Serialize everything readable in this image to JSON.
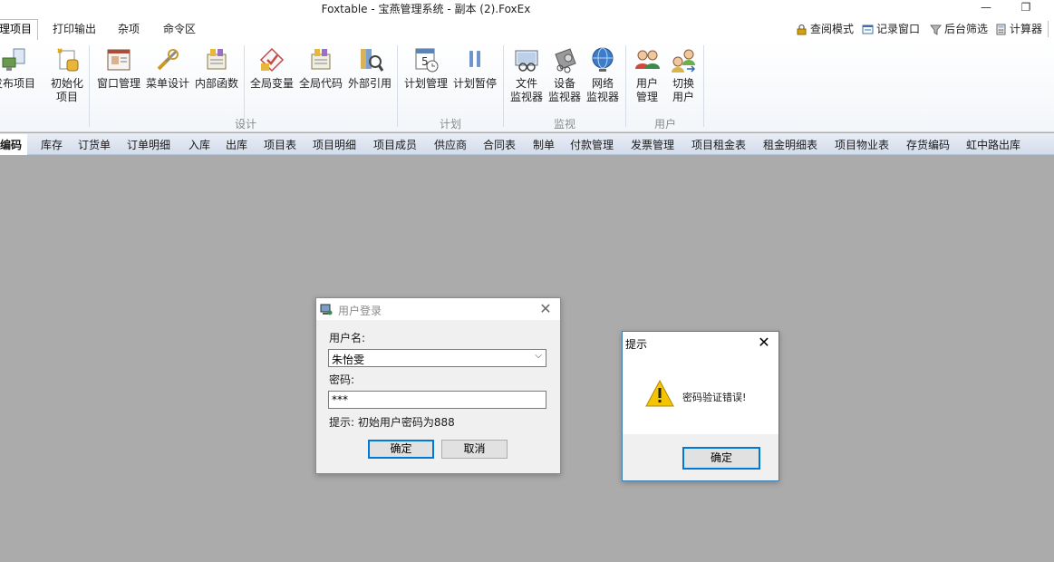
{
  "window": {
    "title": "Foxtable - 宝燕管理系统 - 副本 (2).FoxEx"
  },
  "ribbon_tabs": [
    "理项目",
    "打印输出",
    "杂项",
    "命令区"
  ],
  "quick_access": [
    {
      "label": "查阅模式",
      "icon": "lock-icon"
    },
    {
      "label": "记录窗口",
      "icon": "window-icon"
    },
    {
      "label": "后台筛选",
      "icon": "filter-icon"
    },
    {
      "label": "计算器",
      "icon": "calculator-icon"
    }
  ],
  "ribbon": {
    "buttons": [
      {
        "line1": "发布项目",
        "line2": ""
      },
      {
        "line1": "初始化",
        "line2": "项目"
      },
      {
        "line1": "窗口管理",
        "line2": ""
      },
      {
        "line1": "菜单设计",
        "line2": ""
      },
      {
        "line1": "内部函数",
        "line2": ""
      },
      {
        "line1": "全局变量",
        "line2": ""
      },
      {
        "line1": "全局代码",
        "line2": ""
      },
      {
        "line1": "外部引用",
        "line2": ""
      },
      {
        "line1": "计划管理",
        "line2": ""
      },
      {
        "line1": "计划暂停",
        "line2": ""
      },
      {
        "line1": "文件",
        "line2": "监视器"
      },
      {
        "line1": "设备",
        "line2": "监视器"
      },
      {
        "line1": "网络",
        "line2": "监视器"
      },
      {
        "line1": "用户",
        "line2": "管理"
      },
      {
        "line1": "切换",
        "line2": "用户"
      }
    ],
    "groups": [
      "设计",
      "计划",
      "监视",
      "用户"
    ]
  },
  "table_tabs": [
    "编码",
    "库存",
    "订货单",
    "订单明细",
    "入库",
    "出库",
    "项目表",
    "项目明细",
    "项目成员",
    "供应商",
    "合同表",
    "制单",
    "付款管理",
    "发票管理",
    "项目租金表",
    "租金明细表",
    "项目物业表",
    "存货编码",
    "虹中路出库"
  ],
  "login_dialog": {
    "title": "用户登录",
    "username_label": "用户名:",
    "username_value": "朱怡雯",
    "password_label": "密码:",
    "password_value": "***",
    "hint": "提示: 初始用户密码为888",
    "ok_label": "确定",
    "cancel_label": "取消"
  },
  "alert_dialog": {
    "title": "提示",
    "message": "密码验证错误!",
    "ok_label": "确定"
  }
}
